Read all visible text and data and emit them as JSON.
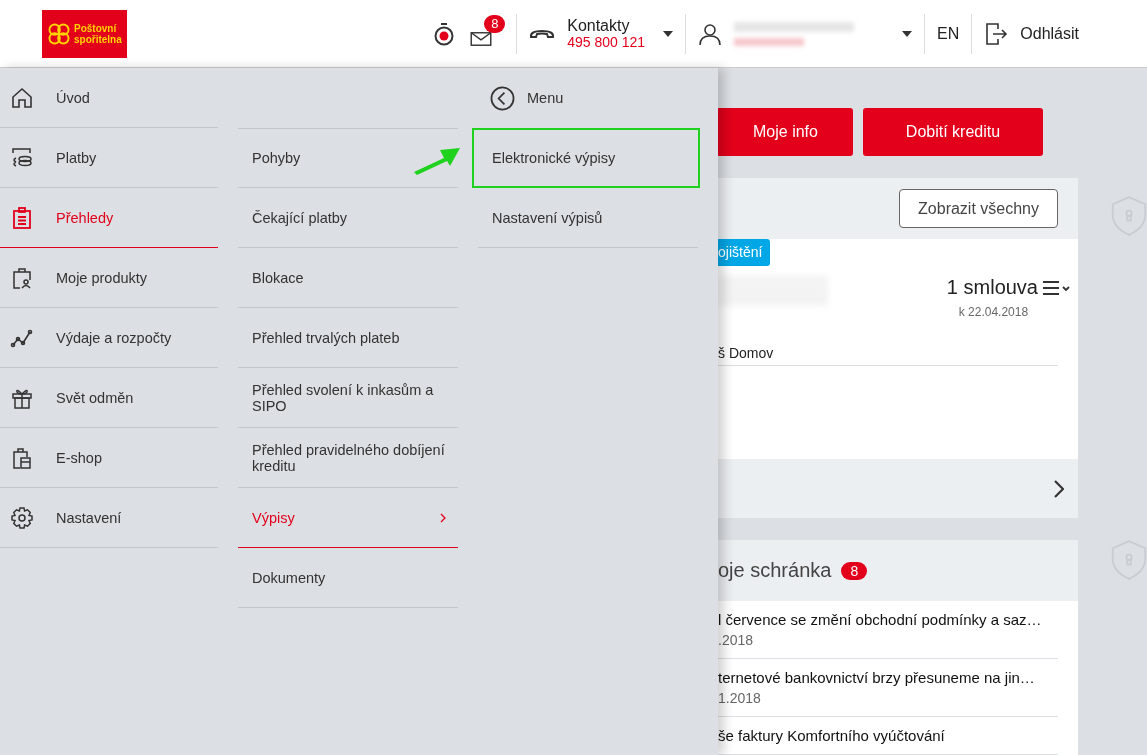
{
  "header": {
    "logo": [
      "Poštovní",
      "spořitelna"
    ],
    "unread_count": "8",
    "contacts": {
      "label": "Kontakty",
      "phone": "495 800 121"
    },
    "language": "EN",
    "logout": "Odhlásit"
  },
  "menu": {
    "primary": [
      {
        "label": "Úvod",
        "kind": "home",
        "selected": false
      },
      {
        "label": "Platby",
        "kind": "coins",
        "selected": false
      },
      {
        "label": "Přehledy",
        "kind": "clipboard",
        "selected": true
      },
      {
        "label": "Moje produkty",
        "kind": "bag",
        "selected": false
      },
      {
        "label": "Výdaje a rozpočty",
        "kind": "chart",
        "selected": false
      },
      {
        "label": "Svět odměn",
        "kind": "gift",
        "selected": false
      },
      {
        "label": "E-shop",
        "kind": "shop",
        "selected": false
      },
      {
        "label": "Nastavení",
        "kind": "gear",
        "selected": false
      }
    ],
    "secondary": [
      {
        "label": "Pohyby",
        "selected": false
      },
      {
        "label": "Čekající platby",
        "selected": false
      },
      {
        "label": "Blokace",
        "selected": false
      },
      {
        "label": "Přehled trvalých plateb",
        "selected": false
      },
      {
        "label": "Přehled svolení k inkasům a SIPO",
        "selected": false
      },
      {
        "label": "Přehled pravidelného dobíjení kreditu",
        "selected": false
      },
      {
        "label": "Výpisy",
        "selected": true
      },
      {
        "label": "Dokumenty",
        "selected": false
      }
    ],
    "tertiary": {
      "back": "Menu",
      "items": [
        {
          "label": "Elektronické výpisy",
          "highlighted": true
        },
        {
          "label": "Nastavení výpisů",
          "highlighted": false
        }
      ]
    }
  },
  "actions": [
    "Moje info",
    "Dobití kreditu"
  ],
  "products": {
    "show_all": "Zobrazit všechny",
    "tag": "ojištění",
    "count": "1 smlouva",
    "date": "k 22.04.2018",
    "item": "š Domov"
  },
  "mailbox": {
    "title": "oje schránka",
    "badge": "8",
    "messages": [
      {
        "title": "l července se změní obchodní podmínky a saz…",
        "date": ".2018"
      },
      {
        "title": "ternetové bankovnictví brzy přesuneme na jin…",
        "date": "1.2018"
      },
      {
        "title": "še faktury Komfortního vyúčtování"
      }
    ]
  }
}
